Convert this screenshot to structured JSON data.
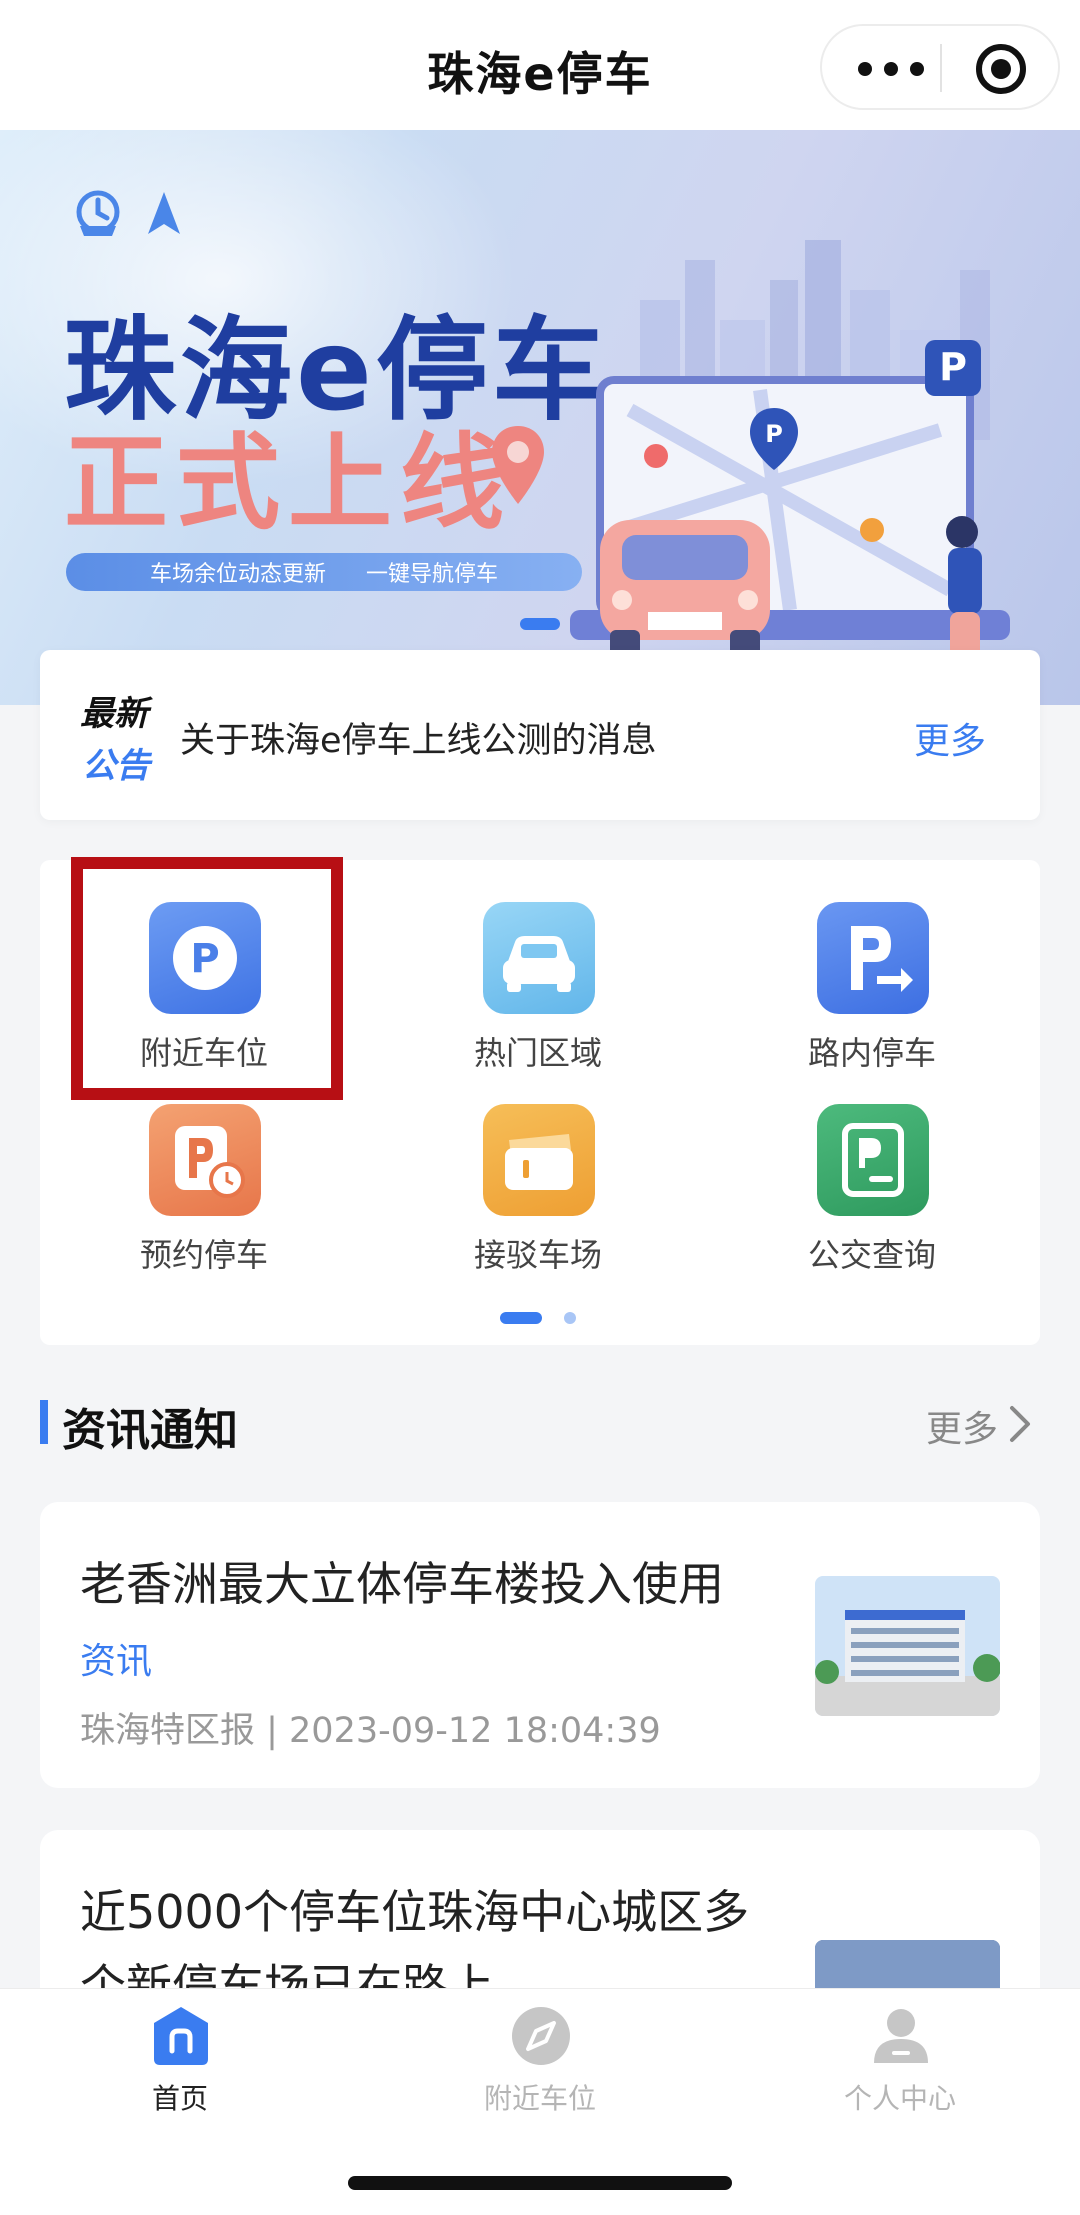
{
  "nav": {
    "title": "珠海e停车"
  },
  "banner": {
    "title_line1": "珠海e停车",
    "title_line2": "正式上线",
    "pill_left": "车场余位动态更新",
    "pill_right": "一键导航停车"
  },
  "announcement": {
    "tag_line1": "最新",
    "tag_line2": "公告",
    "text": "关于珠海e停车上线公测的消息",
    "more": "更多"
  },
  "menu": {
    "items": [
      {
        "label": "附近车位",
        "icon": "parking-circle-icon",
        "color": "#4f86ee"
      },
      {
        "label": "热门区域",
        "icon": "car-icon",
        "color": "#7ec7f1"
      },
      {
        "label": "路内停车",
        "icon": "parking-arrow-icon",
        "color": "#4b7fe8"
      },
      {
        "label": "预约停车",
        "icon": "parking-clock-icon",
        "color": "#ee8a5a"
      },
      {
        "label": "接驳车场",
        "icon": "ticket-icon",
        "color": "#f2ae42"
      },
      {
        "label": "公交查询",
        "icon": "bus-card-icon",
        "color": "#38a86b"
      }
    ],
    "page_count": 2,
    "active_page": 1
  },
  "news_section": {
    "title": "资讯通知",
    "more": "更多"
  },
  "news": [
    {
      "title": "老香洲最大立体停车楼投入使用",
      "category": "资讯",
      "meta": "珠海特区报 | 2023-09-12 18:04:39"
    },
    {
      "title_line1": "近5000个停车位珠海中心城区多",
      "title_line2": "个新停车场已在路上"
    }
  ],
  "tabbar": {
    "items": [
      {
        "label": "首页",
        "icon": "home-icon",
        "active": true
      },
      {
        "label": "附近车位",
        "icon": "compass-icon",
        "active": false
      },
      {
        "label": "个人中心",
        "icon": "user-icon",
        "active": false
      }
    ]
  },
  "colors": {
    "accent": "#3a7cf0",
    "highlight": "#b70f14"
  }
}
